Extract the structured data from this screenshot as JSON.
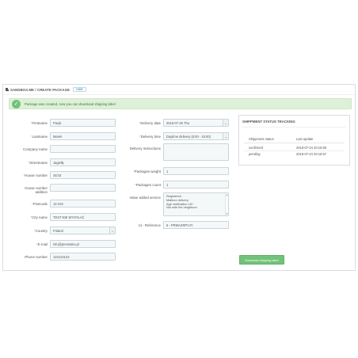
{
  "header": {
    "title": "Sandbox.me / Create Package",
    "button_label": "HIDE"
  },
  "alert": {
    "text": "Package was created, now you can download shipping label"
  },
  "left_form": {
    "firstname": {
      "label": "Firstname",
      "value": "Paryk"
    },
    "lastname": {
      "label": "Lastname",
      "value": "Marek"
    },
    "company": {
      "label": "Company name",
      "value": ""
    },
    "street": {
      "label": "Streetname",
      "value": "Jagiełły"
    },
    "house_number": {
      "label": "House number",
      "value": "34/15"
    },
    "house_addition": {
      "label_line1": "House number",
      "label_line2": "addition",
      "value": ""
    },
    "postcode": {
      "label": "Postcode",
      "value": "12-234"
    },
    "city": {
      "label": "City name",
      "value": "TEST NIE WYSYŁAĆ"
    },
    "country": {
      "label": "Country",
      "value": "Poland"
    },
    "email": {
      "label": "E-mail",
      "value": "info@prestodev.pl"
    },
    "phone": {
      "label": "Phone number",
      "value": "123123123"
    }
  },
  "middle_form": {
    "delivery_date": {
      "label": "Delivery date",
      "value": "2018-07-26 Thu"
    },
    "delivery_time": {
      "label": "Delivery time",
      "value": "Daytime delivery (8:00 - 15:00)"
    },
    "instructions": {
      "label": "Delivery instructions",
      "value": ""
    },
    "weight": {
      "label": "Packages weight",
      "value": "1"
    },
    "count": {
      "label": "Packages count",
      "value": "1"
    },
    "services": {
      "label": "Value added service",
      "options": [
        "Registered",
        "Mailbox delivery",
        "Age verification 18+",
        "Not with the neighbors"
      ]
    },
    "reference": {
      "label": "Id - Reference",
      "value": "6 - PRMAXRPVJY"
    }
  },
  "tracking": {
    "title": "Shippment Status Tracking",
    "col_status": "Shippment status",
    "col_update": "Last update",
    "rows": [
      {
        "status": "confirmed",
        "update": "2018-07-24 20:16:59"
      },
      {
        "status": "pending",
        "update": "2018-07-24 20:16:57"
      }
    ]
  },
  "download_button": "Download shipping label",
  "colors": {
    "accent_green": "#72c279",
    "alert_bg": "#dff0d8",
    "required_star": "#e08f95",
    "link_blue": "#2eacce"
  }
}
